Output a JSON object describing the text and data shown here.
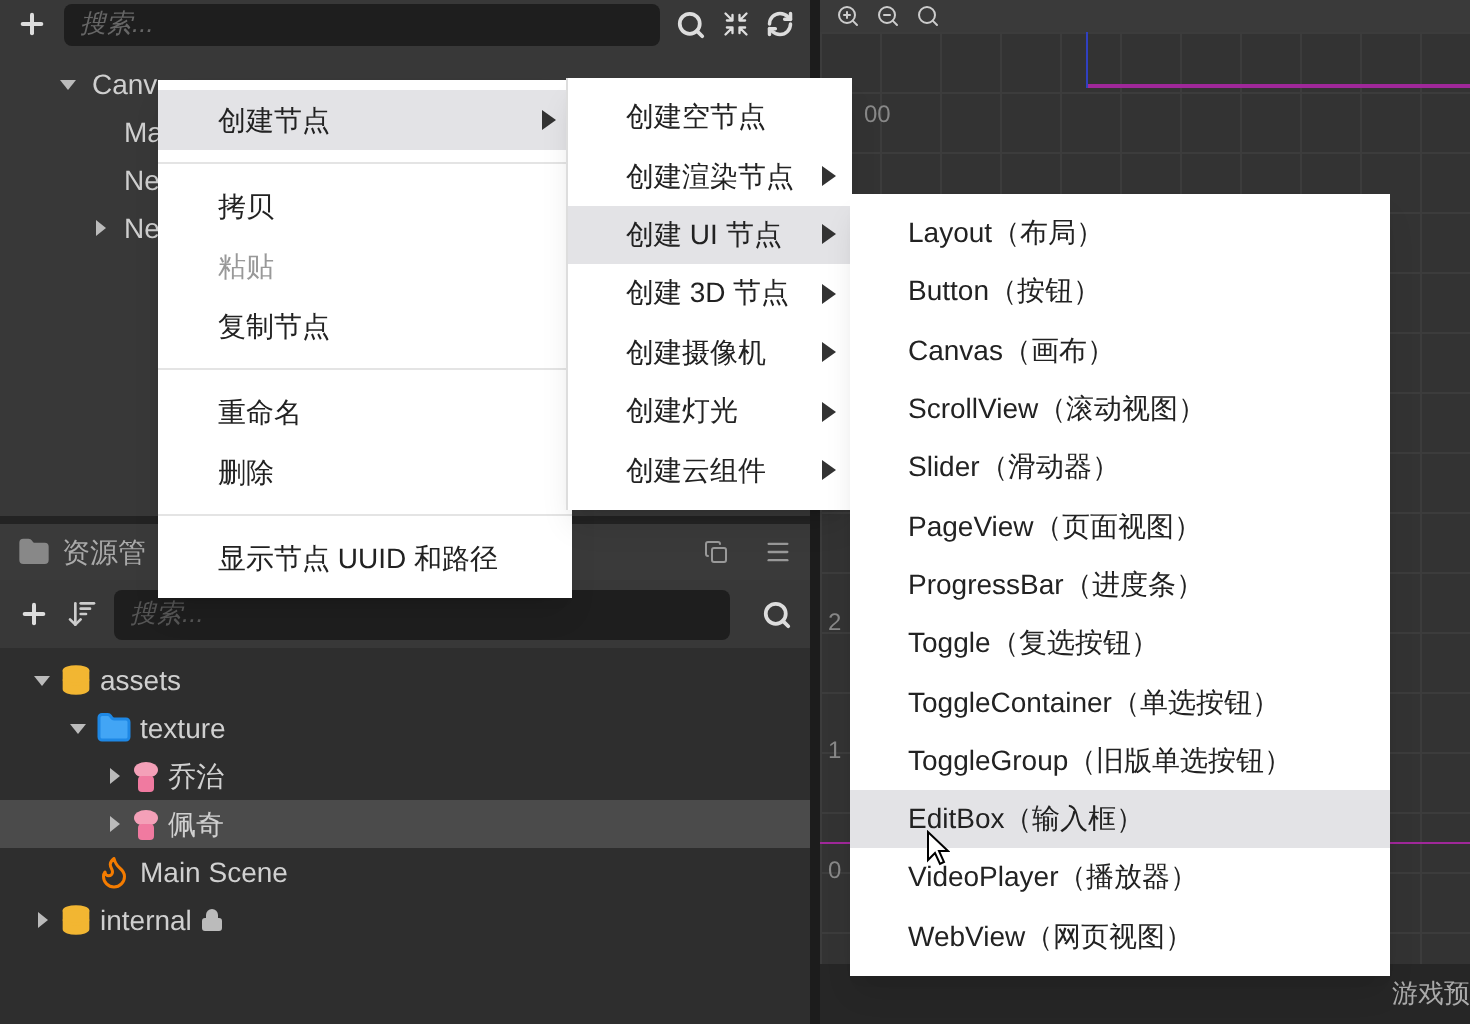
{
  "hierarchy": {
    "search": {
      "placeholder": "搜索..."
    },
    "tree": [
      {
        "label": "Canv",
        "expanded": true,
        "children": [
          {
            "label": "Ma"
          },
          {
            "label": "Ne"
          },
          {
            "label": "Ne",
            "expanded": false
          }
        ]
      }
    ]
  },
  "assets_panel": {
    "title": "资源管",
    "search": {
      "placeholder": "搜索..."
    },
    "tree": [
      {
        "label": "assets",
        "kind": "db",
        "expanded": true,
        "selected": false,
        "children": [
          {
            "label": "texture",
            "kind": "folder",
            "expanded": true,
            "selected": false,
            "children": [
              {
                "label": "乔治",
                "kind": "sprite",
                "expanded": false,
                "selected": false
              },
              {
                "label": "佩奇",
                "kind": "sprite",
                "expanded": false,
                "selected": true
              }
            ]
          },
          {
            "label": "Main Scene",
            "kind": "scene",
            "selected": false
          }
        ]
      },
      {
        "label": "internal",
        "kind": "db",
        "expanded": false,
        "locked": true,
        "selected": false
      }
    ]
  },
  "scene": {
    "ruler_labels": [
      "00",
      "2",
      "1",
      "0"
    ]
  },
  "context_menu": {
    "items": [
      {
        "kind": "item",
        "label": "创建节点",
        "submenu": true,
        "selected": true,
        "disabled": false
      },
      {
        "kind": "separator"
      },
      {
        "kind": "item",
        "label": "拷贝",
        "submenu": false,
        "selected": false,
        "disabled": false
      },
      {
        "kind": "item",
        "label": "粘贴",
        "submenu": false,
        "selected": false,
        "disabled": true
      },
      {
        "kind": "item",
        "label": "复制节点",
        "submenu": false,
        "selected": false,
        "disabled": false
      },
      {
        "kind": "separator"
      },
      {
        "kind": "item",
        "label": "重命名",
        "submenu": false,
        "selected": false,
        "disabled": false
      },
      {
        "kind": "item",
        "label": "删除",
        "submenu": false,
        "selected": false,
        "disabled": false
      },
      {
        "kind": "separator"
      },
      {
        "kind": "item",
        "label": "显示节点 UUID 和路径",
        "submenu": false,
        "selected": false,
        "disabled": false
      }
    ]
  },
  "create_submenu": {
    "items": [
      {
        "label": "创建空节点",
        "submenu": false,
        "selected": false
      },
      {
        "label": "创建渲染节点",
        "submenu": true,
        "selected": false
      },
      {
        "label": "创建 UI 节点",
        "submenu": true,
        "selected": true
      },
      {
        "label": "创建 3D 节点",
        "submenu": true,
        "selected": false
      },
      {
        "label": "创建摄像机",
        "submenu": true,
        "selected": false
      },
      {
        "label": "创建灯光",
        "submenu": true,
        "selected": false
      },
      {
        "label": "创建云组件",
        "submenu": true,
        "selected": false
      }
    ]
  },
  "ui_submenu": {
    "items": [
      {
        "label": "Layout（布局）",
        "selected": false
      },
      {
        "label": "Button（按钮）",
        "selected": false
      },
      {
        "label": "Canvas（画布）",
        "selected": false
      },
      {
        "label": "ScrollView（滚动视图）",
        "selected": false
      },
      {
        "label": "Slider（滑动器）",
        "selected": false
      },
      {
        "label": "PageView（页面视图）",
        "selected": false
      },
      {
        "label": "ProgressBar（进度条）",
        "selected": false
      },
      {
        "label": "Toggle（复选按钮）",
        "selected": false
      },
      {
        "label": "ToggleContainer（单选按钮）",
        "selected": false
      },
      {
        "label": "ToggleGroup（旧版单选按钮）",
        "selected": false
      },
      {
        "label": "EditBox（输入框）",
        "selected": true
      },
      {
        "label": "VideoPlayer（播放器）",
        "selected": false
      },
      {
        "label": "WebView（网页视图）",
        "selected": false
      }
    ]
  },
  "bottom_tabs": [
    {
      "label": "游戏预"
    }
  ]
}
